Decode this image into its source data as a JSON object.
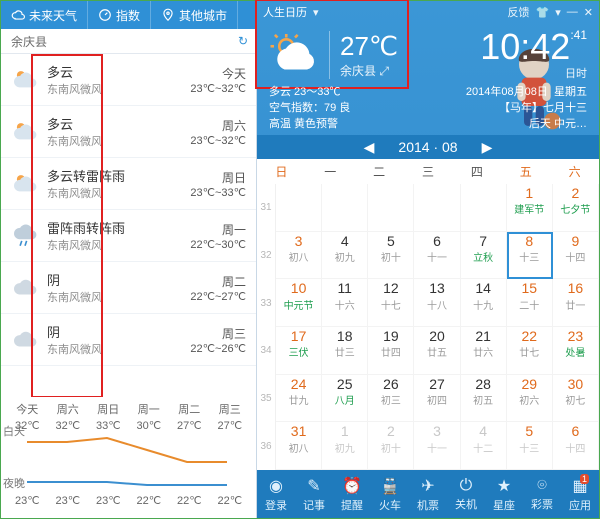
{
  "left": {
    "tabs": {
      "future": "未来天气",
      "index": "指数",
      "cities": "其他城市"
    },
    "search": {
      "value": "余庆县"
    },
    "forecast": [
      {
        "cond": "多云",
        "wind": "东南风微风",
        "day": "今天",
        "temp": "23℃~32℃",
        "icon": "pcloud"
      },
      {
        "cond": "多云",
        "wind": "东南风微风",
        "day": "周六",
        "temp": "23℃~32℃",
        "icon": "pcloud"
      },
      {
        "cond": "多云转雷阵雨",
        "wind": "东南风微风",
        "day": "周日",
        "temp": "23℃~33℃",
        "icon": "pcloud"
      },
      {
        "cond": "雷阵雨转阵雨",
        "wind": "东南风微风",
        "day": "周一",
        "temp": "22℃~30℃",
        "icon": "storm"
      },
      {
        "cond": "阴",
        "wind": "东南风微风",
        "day": "周二",
        "temp": "22℃~27℃",
        "icon": "cloud"
      },
      {
        "cond": "阴",
        "wind": "东南风微风",
        "day": "周三",
        "temp": "22℃~26℃",
        "icon": "cloud"
      }
    ],
    "chart": {
      "labels": [
        "今天",
        "周六",
        "周日",
        "周一",
        "周二",
        "周三"
      ],
      "day_label": "白天",
      "night_label": "夜晚",
      "highs": [
        "32℃",
        "32℃",
        "33℃",
        "30℃",
        "27℃",
        "27℃"
      ],
      "lows": [
        "23℃",
        "23℃",
        "23℃",
        "22℃",
        "22℃",
        "22℃"
      ]
    }
  },
  "right": {
    "topbar": {
      "title": "人生日历",
      "feedback": "反馈"
    },
    "weather": {
      "temp": "27℃",
      "loc": "余庆县",
      "range": "多云 23～33℃",
      "aqi": "空气指数：79 良",
      "warn": "高温  黄色预警"
    },
    "dateinfo": {
      "clock": "10:42",
      "sec": ":41",
      "suffix": "日时",
      "date": "2014年08月08日",
      "dow": "星期五",
      "lunar_year": "【马年】七月十三",
      "aftertomorrow": "后天 中元…"
    },
    "month": {
      "prev": "◀",
      "label": "2014 · 08",
      "next": "▶"
    },
    "dow": [
      "日",
      "一",
      "二",
      "三",
      "四",
      "五",
      "六"
    ],
    "weeks": [
      {
        "wn": "31",
        "days": [
          {
            "n": "",
            "s": ""
          },
          {
            "n": "",
            "s": ""
          },
          {
            "n": "",
            "s": ""
          },
          {
            "n": "",
            "s": ""
          },
          {
            "n": "",
            "s": ""
          },
          {
            "n": "1",
            "s": "建军节",
            "cls": "we fest"
          },
          {
            "n": "2",
            "s": "七夕节",
            "cls": "we fest"
          }
        ]
      },
      {
        "wn": "32",
        "days": [
          {
            "n": "3",
            "s": "初八",
            "cls": "we"
          },
          {
            "n": "4",
            "s": "初九"
          },
          {
            "n": "5",
            "s": "初十"
          },
          {
            "n": "6",
            "s": "十一"
          },
          {
            "n": "7",
            "s": "立秋",
            "cls": "fest"
          },
          {
            "n": "8",
            "s": "十三",
            "cls": "we today"
          },
          {
            "n": "9",
            "s": "十四",
            "cls": "we"
          }
        ]
      },
      {
        "wn": "33",
        "days": [
          {
            "n": "10",
            "s": "中元节",
            "cls": "we fest"
          },
          {
            "n": "11",
            "s": "十六"
          },
          {
            "n": "12",
            "s": "十七"
          },
          {
            "n": "13",
            "s": "十八"
          },
          {
            "n": "14",
            "s": "十九"
          },
          {
            "n": "15",
            "s": "二十",
            "cls": "we"
          },
          {
            "n": "16",
            "s": "廿一",
            "cls": "we"
          }
        ]
      },
      {
        "wn": "34",
        "days": [
          {
            "n": "17",
            "s": "三伏",
            "cls": "we fest"
          },
          {
            "n": "18",
            "s": "廿三"
          },
          {
            "n": "19",
            "s": "廿四"
          },
          {
            "n": "20",
            "s": "廿五"
          },
          {
            "n": "21",
            "s": "廿六"
          },
          {
            "n": "22",
            "s": "廿七",
            "cls": "we"
          },
          {
            "n": "23",
            "s": "处暑",
            "cls": "we fest"
          }
        ]
      },
      {
        "wn": "35",
        "days": [
          {
            "n": "24",
            "s": "廿九",
            "cls": "we"
          },
          {
            "n": "25",
            "s": "八月",
            "cls": "fest"
          },
          {
            "n": "26",
            "s": "初三"
          },
          {
            "n": "27",
            "s": "初四"
          },
          {
            "n": "28",
            "s": "初五"
          },
          {
            "n": "29",
            "s": "初六",
            "cls": "we"
          },
          {
            "n": "30",
            "s": "初七",
            "cls": "we"
          }
        ]
      },
      {
        "wn": "36",
        "days": [
          {
            "n": "31",
            "s": "初八",
            "cls": "we"
          },
          {
            "n": "1",
            "s": "初九",
            "cls": "other"
          },
          {
            "n": "2",
            "s": "初十",
            "cls": "other"
          },
          {
            "n": "3",
            "s": "十一",
            "cls": "other"
          },
          {
            "n": "4",
            "s": "十二",
            "cls": "other"
          },
          {
            "n": "5",
            "s": "十三",
            "cls": "other we"
          },
          {
            "n": "6",
            "s": "十四",
            "cls": "other we"
          }
        ]
      }
    ],
    "dock": [
      {
        "label": "登录",
        "icon": "user"
      },
      {
        "label": "记事",
        "icon": "note"
      },
      {
        "label": "提醒",
        "icon": "bell"
      },
      {
        "label": "火车",
        "icon": "train"
      },
      {
        "label": "机票",
        "icon": "plane"
      },
      {
        "label": "关机",
        "icon": "power"
      },
      {
        "label": "星座",
        "icon": "star"
      },
      {
        "label": "彩票",
        "icon": "ticket"
      },
      {
        "label": "应用",
        "icon": "apps",
        "badge": "1"
      }
    ]
  },
  "chart_data": {
    "type": "line",
    "title": "",
    "xlabel": "",
    "ylabel": "℃",
    "categories": [
      "今天",
      "周六",
      "周日",
      "周一",
      "周二",
      "周三"
    ],
    "series": [
      {
        "name": "白天",
        "values": [
          32,
          32,
          33,
          30,
          27,
          27
        ]
      },
      {
        "name": "夜晚",
        "values": [
          23,
          23,
          23,
          22,
          22,
          22
        ]
      }
    ],
    "ylim": [
      20,
      35
    ]
  }
}
